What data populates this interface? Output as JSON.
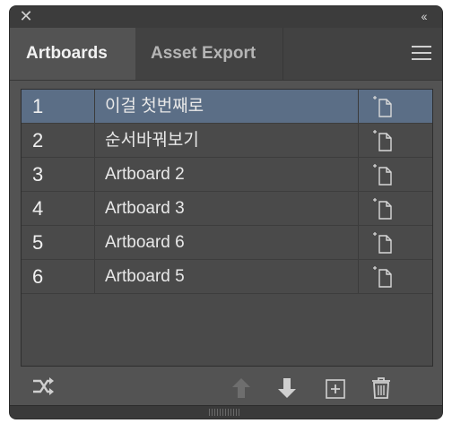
{
  "window": {
    "close_icon": "close-icon",
    "collapse_icon": "double-chevron-left-icon"
  },
  "tabs": [
    {
      "label": "Artboards",
      "active": true
    },
    {
      "label": "Asset Export",
      "active": false
    }
  ],
  "menu_icon": "hamburger-menu-icon",
  "artboards": [
    {
      "num": "1",
      "name": "이걸 첫번째로",
      "selected": true
    },
    {
      "num": "2",
      "name": "순서바꿔보기",
      "selected": false
    },
    {
      "num": "3",
      "name": "Artboard 2",
      "selected": false
    },
    {
      "num": "4",
      "name": "Artboard 3",
      "selected": false
    },
    {
      "num": "5",
      "name": "Artboard 6",
      "selected": false
    },
    {
      "num": "6",
      "name": "Artboard 5",
      "selected": false
    }
  ],
  "footer": {
    "rearrange_icon": "rearrange-artboards-icon",
    "move_up_icon": "arrow-up-icon",
    "move_down_icon": "arrow-down-icon",
    "new_artboard_icon": "new-artboard-icon",
    "delete_icon": "trash-icon"
  },
  "colors": {
    "panel_bg": "#535353",
    "selected_row": "#5b6e86",
    "tab_bar": "#424242"
  }
}
